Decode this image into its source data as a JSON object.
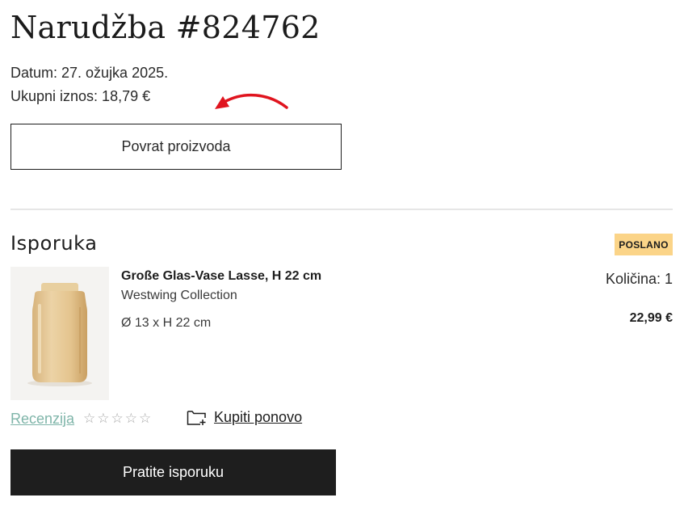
{
  "order": {
    "title": "Narudžba #824762",
    "date_line": "Datum: 27. ožujka 2025.",
    "total_line": "Ukupni iznos: 18,79 €",
    "return_button": "Povrat proizvoda"
  },
  "delivery": {
    "section_title": "Isporuka",
    "status_badge": "POSLANO",
    "status_color": "#fbd488",
    "product": {
      "name": "Große Glas-Vase Lasse, H 22 cm",
      "brand": "Westwing Collection",
      "dimensions": "Ø 13 x H 22 cm",
      "quantity": "Količina: 1",
      "price": "22,99 €",
      "image_icon": "glass-vase-image"
    },
    "review_link": "Recenzija",
    "rating": {
      "max": 5,
      "value": 0,
      "star_glyph": "☆"
    },
    "rebuy_label": "Kupiti ponovo",
    "rebuy_icon": "folder-plus-icon",
    "track_button": "Pratite isporuku"
  },
  "colors": {
    "accent_link": "#7fb5a9",
    "annotation_arrow": "#e0141e",
    "primary_button_bg": "#1e1e1e"
  }
}
